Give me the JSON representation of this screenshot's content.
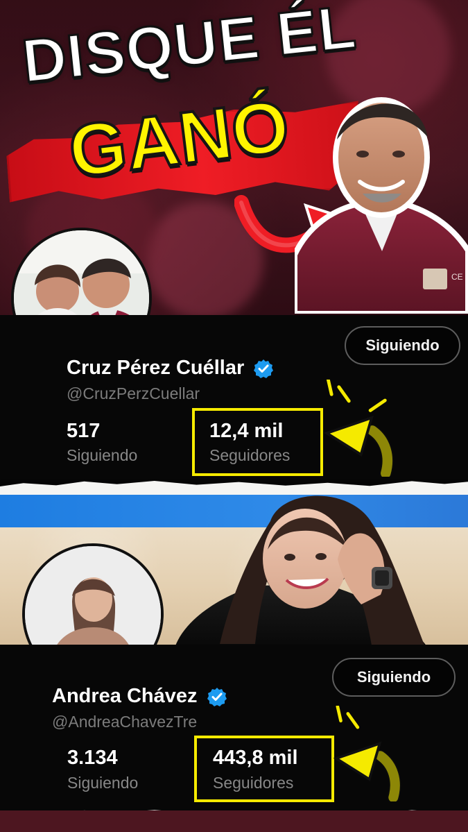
{
  "headline": {
    "line1": "DISQUE ÉL",
    "line2": "GANÓ"
  },
  "profiles": [
    {
      "follow_button": "Siguiendo",
      "name": "Cruz Pérez Cuéllar",
      "handle": "@CruzPerzCuellar",
      "following_count": "517",
      "following_label": "Siguiendo",
      "followers_count": "12,4 mil",
      "followers_label": "Seguidores"
    },
    {
      "follow_button": "Siguiendo",
      "name": "Andrea Chávez",
      "handle": "@AndreaChavezTre",
      "following_count": "3.134",
      "following_label": "Siguiendo",
      "followers_count": "443,8 mil",
      "followers_label": "Seguidores"
    }
  ],
  "colors": {
    "accent_yellow": "#f5ea00",
    "accent_red": "#ef1d25",
    "verified_blue": "#1d9bf0",
    "card_bg": "#070707"
  },
  "icons": {
    "verified": "verified-badge-icon",
    "red_arrow": "arrow-right-icon",
    "yellow_arrow": "arrow-pointer-icon"
  }
}
